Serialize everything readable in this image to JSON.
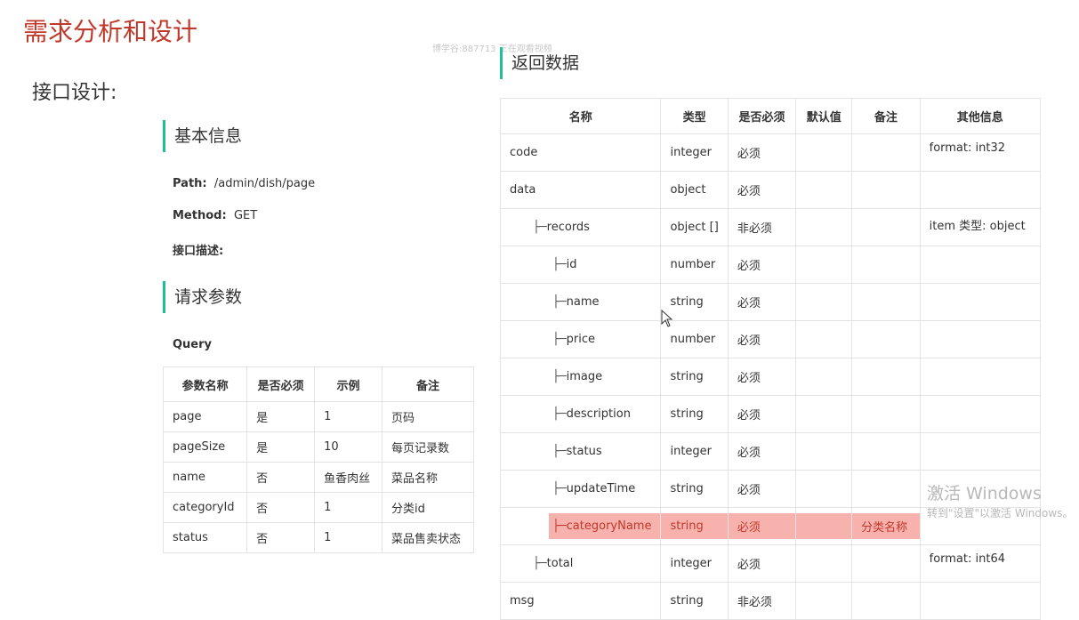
{
  "slide_title": "需求分析和设计",
  "watermark": "博学谷:887713 正在观看视频",
  "interface_label": "接口设计:",
  "basic_info": {
    "heading": "基本信息",
    "path_label": "Path:",
    "path_value": "/admin/dish/page",
    "method_label": "Method:",
    "method_value": "GET",
    "desc_label": "接口描述:"
  },
  "request_params": {
    "heading": "请求参数",
    "query_label": "Query",
    "columns": [
      "参数名称",
      "是否必须",
      "示例",
      "备注"
    ],
    "rows": [
      [
        "page",
        "是",
        "1",
        "页码"
      ],
      [
        "pageSize",
        "是",
        "10",
        "每页记录数"
      ],
      [
        "name",
        "否",
        "鱼香肉丝",
        "菜品名称"
      ],
      [
        "categoryId",
        "否",
        "1",
        "分类id"
      ],
      [
        "status",
        "否",
        "1",
        "菜品售卖状态"
      ]
    ]
  },
  "response": {
    "heading": "返回数据",
    "columns": [
      "名称",
      "类型",
      "是否必须",
      "默认值",
      "备注",
      "其他信息"
    ],
    "rows": [
      {
        "name": "code",
        "prefix": "",
        "indent": 0,
        "type": "integer",
        "required": "必须",
        "default": "",
        "note": "",
        "other": "format: int32"
      },
      {
        "name": "data",
        "prefix": "",
        "indent": 0,
        "type": "object",
        "required": "必须",
        "default": "",
        "note": "",
        "other": ""
      },
      {
        "name": "records",
        "prefix": "├─",
        "indent": 1,
        "type": "object []",
        "required": "非必须",
        "default": "",
        "note": "",
        "other": "item 类型: object"
      },
      {
        "name": "id",
        "prefix": "├─",
        "indent": 2,
        "type": "number",
        "required": "必须",
        "default": "",
        "note": "",
        "other": ""
      },
      {
        "name": "name",
        "prefix": "├─",
        "indent": 2,
        "type": "string",
        "required": "必须",
        "default": "",
        "note": "",
        "other": ""
      },
      {
        "name": "price",
        "prefix": "├─",
        "indent": 2,
        "type": "number",
        "required": "必须",
        "default": "",
        "note": "",
        "other": ""
      },
      {
        "name": "image",
        "prefix": "├─",
        "indent": 2,
        "type": "string",
        "required": "必须",
        "default": "",
        "note": "",
        "other": ""
      },
      {
        "name": "description",
        "prefix": "├─",
        "indent": 2,
        "type": "string",
        "required": "必须",
        "default": "",
        "note": "",
        "other": ""
      },
      {
        "name": "status",
        "prefix": "├─",
        "indent": 2,
        "type": "integer",
        "required": "必须",
        "default": "",
        "note": "",
        "other": ""
      },
      {
        "name": "updateTime",
        "prefix": "├─",
        "indent": 2,
        "type": "string",
        "required": "必须",
        "default": "",
        "note": "",
        "other": ""
      },
      {
        "name": "categoryName",
        "prefix": "├─",
        "indent": 2,
        "type": "string",
        "required": "必须",
        "default": "",
        "note": "分类名称",
        "other": "",
        "highlight": true
      },
      {
        "name": "total",
        "prefix": "├─",
        "indent": 1,
        "type": "integer",
        "required": "必须",
        "default": "",
        "note": "",
        "other": "format: int64"
      },
      {
        "name": "msg",
        "prefix": "",
        "indent": 0,
        "type": "string",
        "required": "非必须",
        "default": "",
        "note": "",
        "other": ""
      }
    ]
  },
  "windows_activation": {
    "line1": "激活 Windows",
    "line2": "转到\"设置\"以激活 Windows。"
  },
  "colors": {
    "title_red": "#c0392b",
    "accent_teal": "#1fbf9a",
    "highlight_pink": "#f7b2ae"
  }
}
